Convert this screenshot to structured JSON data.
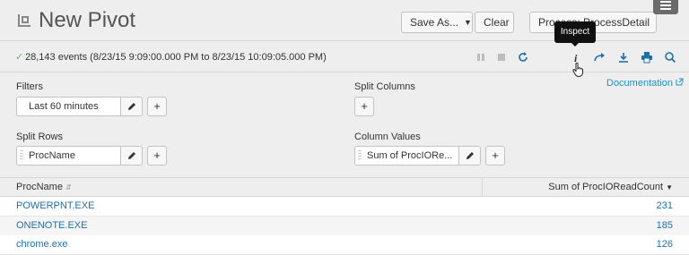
{
  "header": {
    "title": "New Pivot",
    "save_as_label": "Save As...",
    "clear_label": "Clear",
    "dataset_label": "Process: ProcessDetail"
  },
  "tooltip": {
    "text": "Inspect"
  },
  "status": {
    "check": "✓",
    "events_text": "28,143 events (8/23/15 9:09:00.000 PM to 8/23/15 10:09:05.000 PM)"
  },
  "panels": {
    "filters": {
      "label": "Filters",
      "pill": "Last 60 minutes",
      "add": "+"
    },
    "split_columns": {
      "label": "Split Columns",
      "add": "+"
    },
    "split_rows": {
      "label": "Split Rows",
      "pill": "ProcName",
      "add": "+"
    },
    "column_values": {
      "label": "Column Values",
      "pill": "Sum of ProcIORe...",
      "add": "+"
    },
    "documentation": "Documentation"
  },
  "table": {
    "headers": [
      "ProcName",
      "Sum of ProcIOReadCount"
    ],
    "rows": [
      {
        "name": "POWERPNT.EXE",
        "value": "231"
      },
      {
        "name": "ONENOTE.EXE",
        "value": "185"
      },
      {
        "name": "chrome.exe",
        "value": "126"
      }
    ]
  },
  "colors": {
    "background": "#eeeeee",
    "link": "#1e93c6",
    "row_text": "#1e6fae",
    "success": "#5cc05c",
    "tooltip": "#111111"
  }
}
